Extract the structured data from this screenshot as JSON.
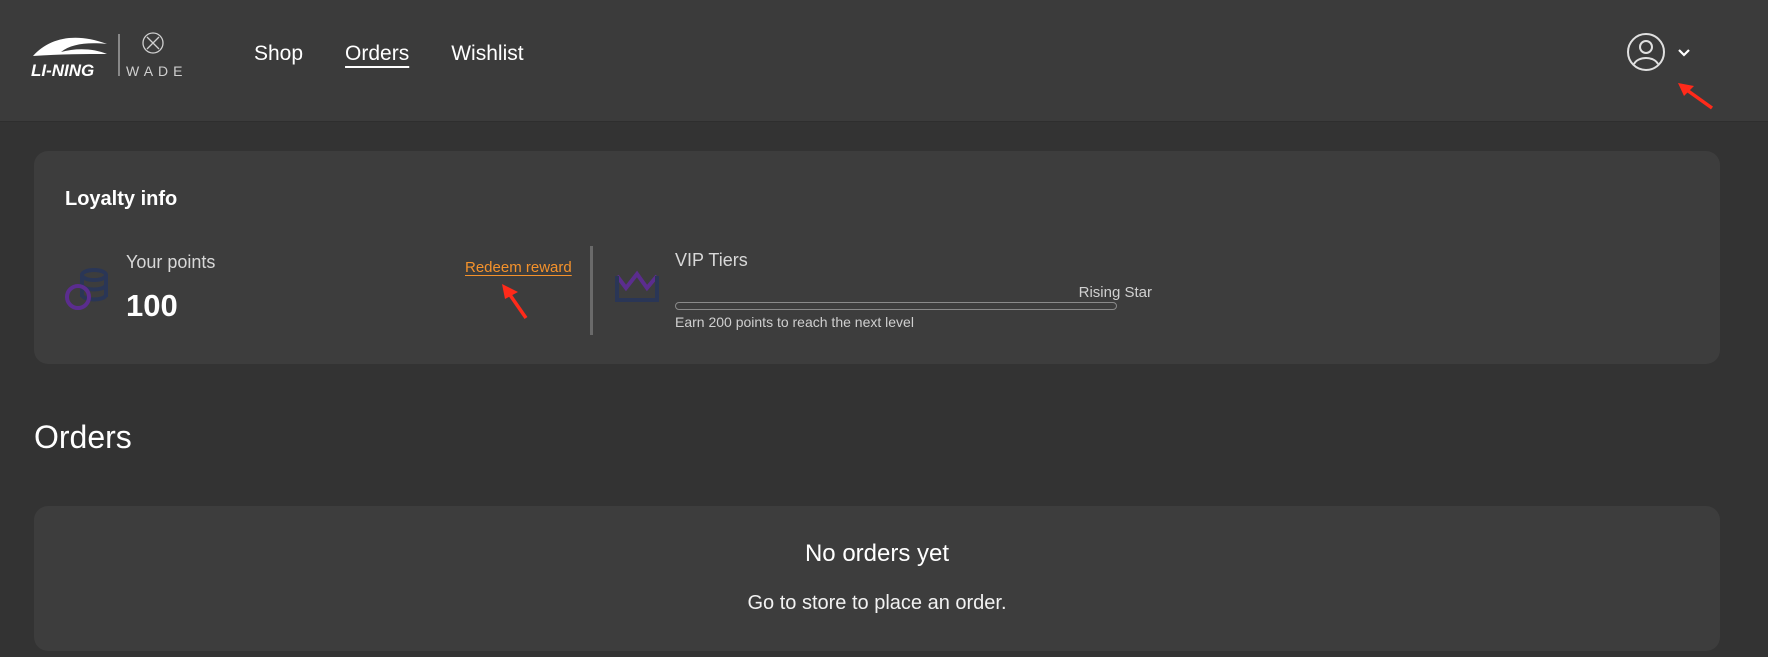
{
  "brand": {
    "logo_text": "LI-NING",
    "sub_logo_text": "WADE"
  },
  "nav": {
    "items": [
      {
        "label": "Shop",
        "active": false
      },
      {
        "label": "Orders",
        "active": true
      },
      {
        "label": "Wishlist",
        "active": false
      }
    ]
  },
  "account": {
    "icon": "user-circle-icon",
    "dropdown_icon": "chevron-down-icon"
  },
  "loyalty": {
    "title": "Loyalty info",
    "points_label": "Your points",
    "points_value": "100",
    "redeem_label": "Redeem reward",
    "tiers_label": "VIP Tiers",
    "tier_name": "Rising Star",
    "tier_progress": 0,
    "tier_hint": "Earn 200 points to reach the next level",
    "accent_color": "#f5922b",
    "icon_color": "#5b2d8e"
  },
  "orders": {
    "heading": "Orders",
    "empty_title": "No orders yet",
    "empty_subtitle": "Go to store to place an order."
  },
  "annotation_color": "#ff2a1a"
}
